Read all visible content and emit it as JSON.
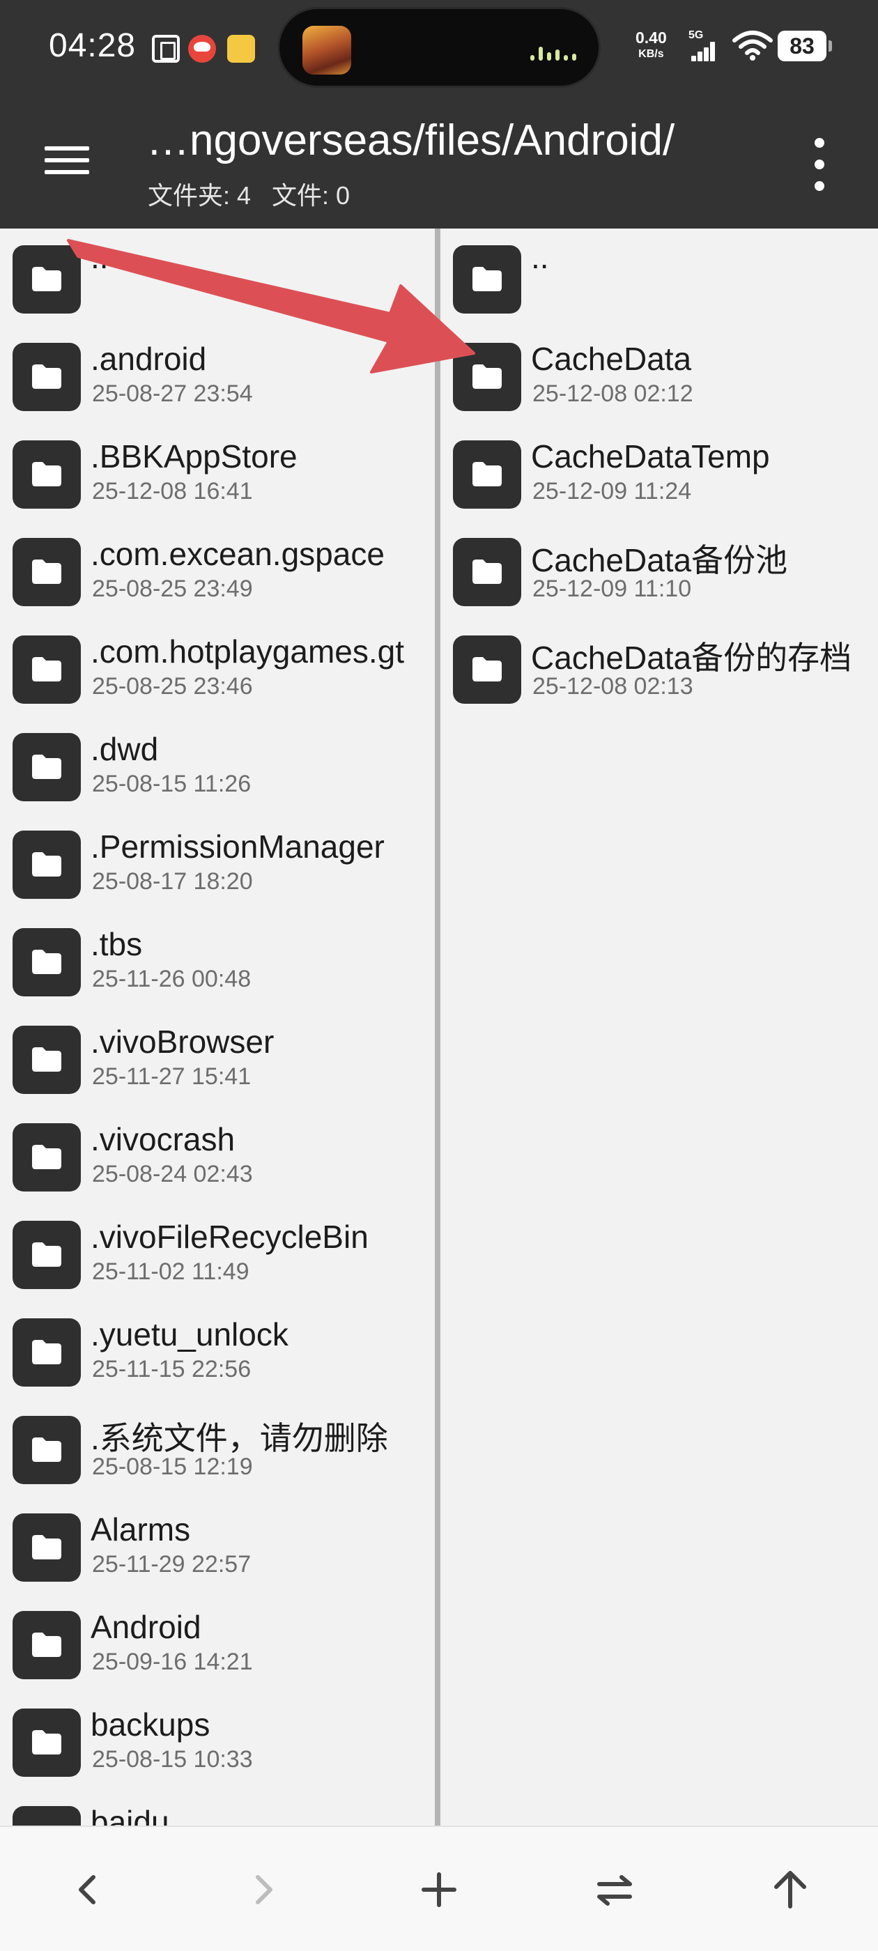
{
  "status_bar": {
    "time": "04:28",
    "net_speed": "0.40",
    "net_unit": "KB/s",
    "network_type": "5G",
    "battery": "83",
    "icons": [
      "tuan-icon",
      "red-app-icon",
      "yellow-app-icon",
      "game-thumbnail",
      "audio-wave-icon",
      "signal-icon",
      "wifi-icon",
      "battery-icon"
    ]
  },
  "app_bar": {
    "path": "…ngoverseas/files/Android/",
    "counts": "文件夹: 4   文件: 0",
    "icons": [
      "menu-icon",
      "more-vert-icon"
    ]
  },
  "left_pane": {
    "parent_label": "..",
    "items": [
      {
        "name": ".android",
        "date": "25-08-27 23:54"
      },
      {
        "name": ".BBKAppStore",
        "date": "25-12-08 16:41"
      },
      {
        "name": ".com.excean.gspace",
        "date": "25-08-25 23:49"
      },
      {
        "name": ".com.hotplaygames.gt",
        "date": "25-08-25 23:46"
      },
      {
        "name": ".dwd",
        "date": "25-08-15 11:26"
      },
      {
        "name": ".PermissionManager",
        "date": "25-08-17 18:20"
      },
      {
        "name": ".tbs",
        "date": "25-11-26 00:48"
      },
      {
        "name": ".vivoBrowser",
        "date": "25-11-27 15:41"
      },
      {
        "name": ".vivocrash",
        "date": "25-08-24 02:43"
      },
      {
        "name": ".vivoFileRecycleBin",
        "date": "25-11-02 11:49"
      },
      {
        "name": ".yuetu_unlock",
        "date": "25-11-15 22:56"
      },
      {
        "name": ".系统文件，请勿删除",
        "date": "25-08-15 12:19"
      },
      {
        "name": "Alarms",
        "date": "25-11-29 22:57"
      },
      {
        "name": "Android",
        "date": "25-09-16 14:21"
      },
      {
        "name": "backups",
        "date": "25-08-15 10:33"
      },
      {
        "name": "baidu",
        "date": ""
      }
    ]
  },
  "right_pane": {
    "parent_label": "..",
    "items": [
      {
        "name": "CacheData",
        "date": "25-12-08 02:12"
      },
      {
        "name": "CacheDataTemp",
        "date": "25-12-09 11:24"
      },
      {
        "name": "CacheData备份池",
        "date": "25-12-09 11:10"
      },
      {
        "name": "CacheData备份的存档",
        "date": "25-12-08 02:13"
      }
    ]
  },
  "bottom_bar": {
    "buttons": [
      "back-icon",
      "forward-icon",
      "add-icon",
      "swap-icon",
      "up-icon"
    ]
  },
  "colors": {
    "header": "#333333",
    "folder_icon": "#2f2f2f",
    "arrow": "#dc5055",
    "background": "#f2f2f2"
  }
}
